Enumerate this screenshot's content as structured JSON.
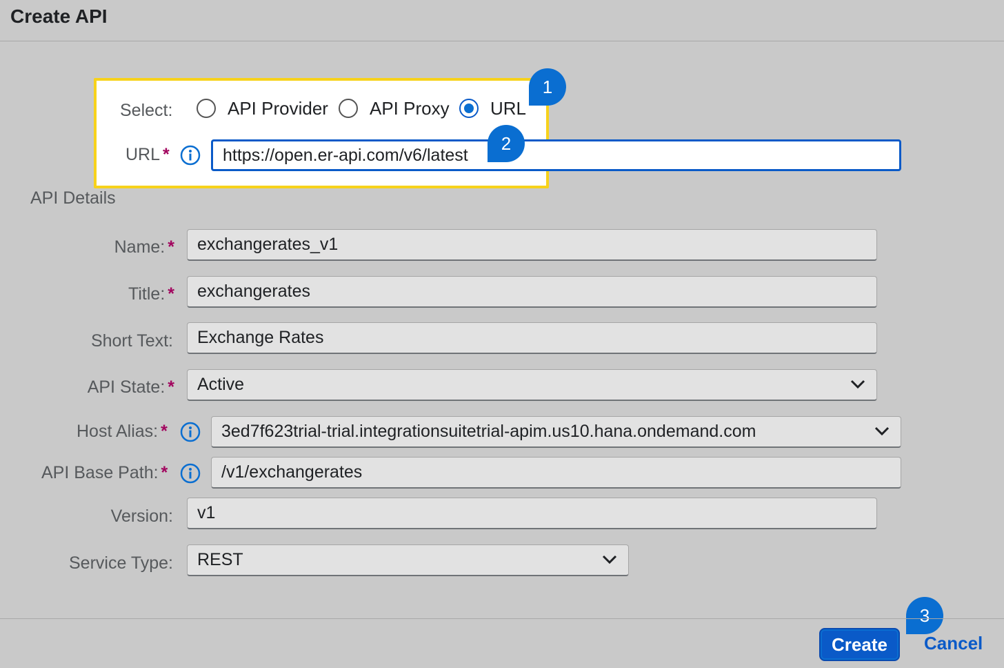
{
  "dialog": {
    "title": "Create API"
  },
  "select": {
    "label": "Select:",
    "options": [
      {
        "label": "API Provider",
        "checked": false
      },
      {
        "label": "API Proxy",
        "checked": false
      },
      {
        "label": "URL",
        "checked": true
      }
    ]
  },
  "url": {
    "label": "URL",
    "required": "*",
    "value": "https://open.er-api.com/v6/latest"
  },
  "details": {
    "section_title": "API Details",
    "name": {
      "label": "Name:",
      "required": "*",
      "value": "exchangerates_v1"
    },
    "title": {
      "label": "Title:",
      "required": "*",
      "value": "exchangerates"
    },
    "short_text": {
      "label": "Short Text:",
      "value": "Exchange Rates"
    },
    "api_state": {
      "label": "API State:",
      "required": "*",
      "value": "Active"
    },
    "host_alias": {
      "label": "Host Alias:",
      "required": "*",
      "value": "3ed7f623trial-trial.integrationsuitetrial-apim.us10.hana.ondemand.com"
    },
    "base_path": {
      "label": "API Base Path:",
      "required": "*",
      "value": "/v1/exchangerates"
    },
    "version": {
      "label": "Version:",
      "value": "v1"
    },
    "service_type": {
      "label": "Service Type:",
      "value": "REST"
    }
  },
  "callouts": [
    "1",
    "2",
    "3"
  ],
  "footer": {
    "create_label": "Create",
    "cancel_label": "Cancel"
  },
  "colors": {
    "accent": "#0a6ed1",
    "highlight": "#f7d21b",
    "required": "#a2065f"
  }
}
